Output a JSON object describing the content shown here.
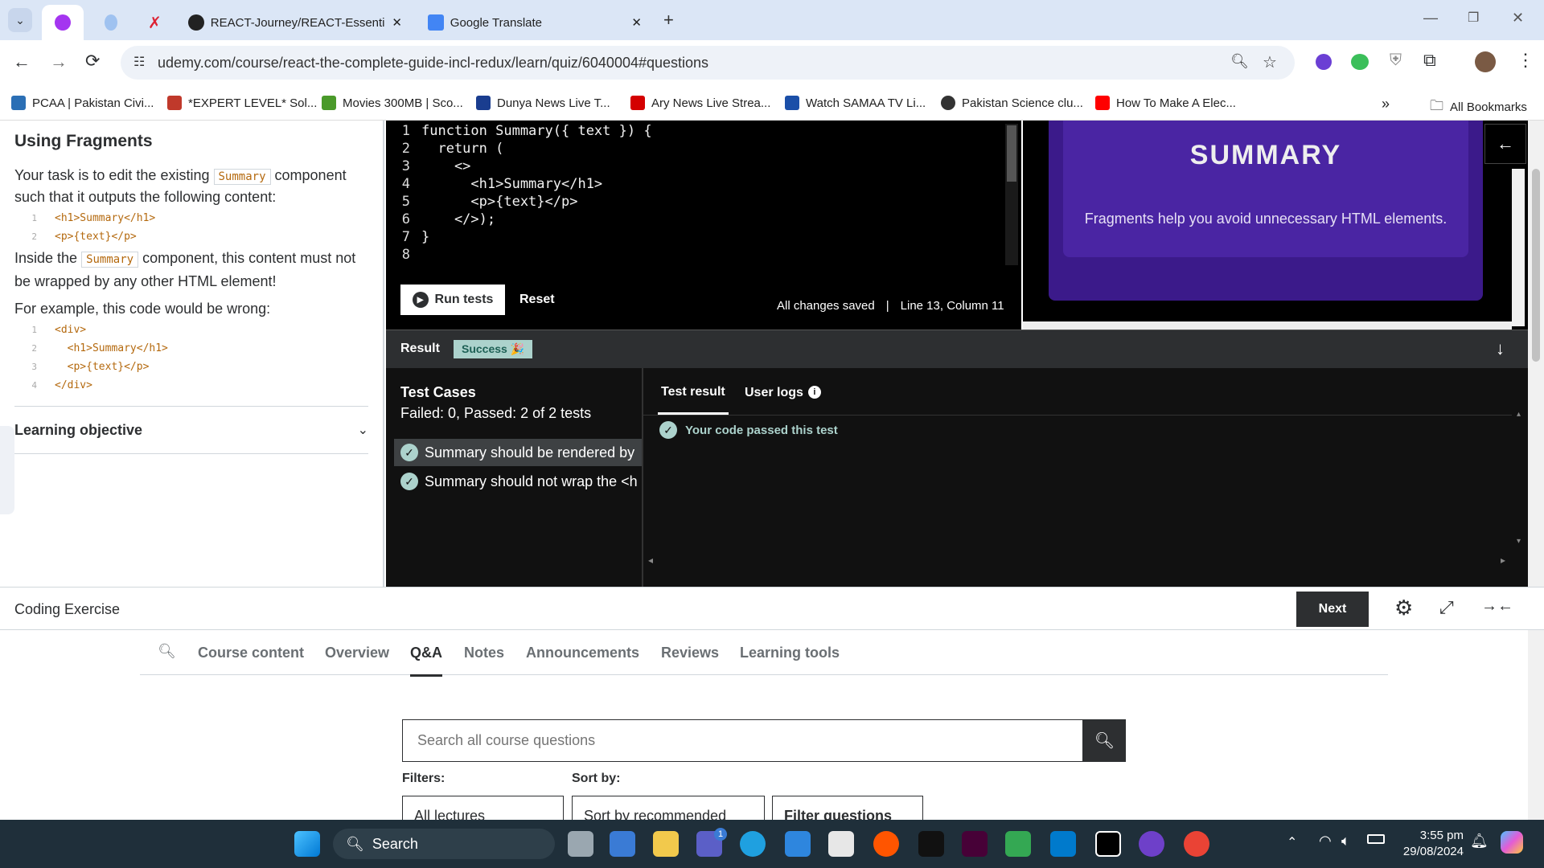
{
  "browser": {
    "tabs": [
      {
        "label": ""
      },
      {
        "label": ""
      },
      {
        "label": ""
      },
      {
        "label": "REACT-Journey/REACT-Essentia"
      },
      {
        "label": "Google Translate"
      }
    ],
    "url": "udemy.com/course/react-the-complete-guide-incl-redux/learn/quiz/6040004#questions",
    "bookmarks": [
      "PCAA | Pakistan Civi...",
      "*EXPERT LEVEL* Sol...",
      "Movies 300MB | Sco...",
      "Dunya News Live T...",
      "Ary News Live Strea...",
      "Watch SAMAA TV Li...",
      "Pakistan Science clu...",
      "How To Make A Elec..."
    ],
    "bookmarks_overflow": "»",
    "all_bookmarks": "All Bookmarks"
  },
  "task": {
    "title": "Using Fragments",
    "p1_before": "Your task is to edit the existing",
    "p1_code": "Summary",
    "p1_after": "component",
    "p1_line2": "such that it outputs the following content:",
    "snippet1": [
      {
        "num": "1",
        "code": "<h1>Summary</h1>"
      },
      {
        "num": "2",
        "code": "<p>{text}</p>"
      }
    ],
    "p2_before": "Inside the",
    "p2_code": "Summary",
    "p2_after": "component, this content must not",
    "p2_line2": "be wrapped by any other HTML element!",
    "p3": "For example, this code would be wrong:",
    "snippet2": [
      {
        "num": "1",
        "code": "<div>"
      },
      {
        "num": "2",
        "code": "  <h1>Summary</h1>"
      },
      {
        "num": "3",
        "code": "  <p>{text}</p>"
      },
      {
        "num": "4",
        "code": "</div>"
      }
    ],
    "learning_objective": "Learning objective"
  },
  "editor": {
    "lines": [
      {
        "num": "1",
        "text": "function Summary({ text }) {"
      },
      {
        "num": "2",
        "text": "  return ("
      },
      {
        "num": "3",
        "text": "    <>"
      },
      {
        "num": "4",
        "text": "      <h1>Summary</h1>"
      },
      {
        "num": "5",
        "text": "      <p>{text}</p>"
      },
      {
        "num": "6",
        "text": "    </>);"
      },
      {
        "num": "7",
        "text": "}"
      },
      {
        "num": "8",
        "text": ""
      }
    ],
    "run_tests": "Run tests",
    "reset": "Reset",
    "save_status": "All changes saved",
    "separator": "|",
    "cursor": "Line 13, Column 11"
  },
  "preview": {
    "heading": "SUMMARY",
    "text": "Fragments help you avoid unnecessary HTML elements."
  },
  "result": {
    "label": "Result",
    "badge": "Success 🎉",
    "test_cases_title": "Test Cases",
    "test_cases_summary": "Failed: 0, Passed: 2 of 2 tests",
    "cases": [
      "Summary should be rendered by",
      "Summary should not wrap the <h"
    ],
    "tab_test_result": "Test result",
    "tab_user_logs": "User logs",
    "pass_message": "Your code passed this test"
  },
  "footer": {
    "coding_exercise": "Coding Exercise",
    "next": "Next"
  },
  "course_tabs": [
    "Course content",
    "Overview",
    "Q&A",
    "Notes",
    "Announcements",
    "Reviews",
    "Learning tools"
  ],
  "qa": {
    "search_placeholder": "Search all course questions",
    "filters_label": "Filters:",
    "sort_label": "Sort by:",
    "filter_select": "All lectures",
    "sort_select": "Sort by recommended",
    "filter_questions": "Filter questions"
  },
  "taskbar": {
    "search": "Search",
    "time": "3:55 pm",
    "date": "29/08/2024",
    "teams_badge": "1"
  },
  "colors": {
    "accent": "#5624d0",
    "success": "#acd2cc",
    "preview_bg": "#3b1a8a"
  }
}
